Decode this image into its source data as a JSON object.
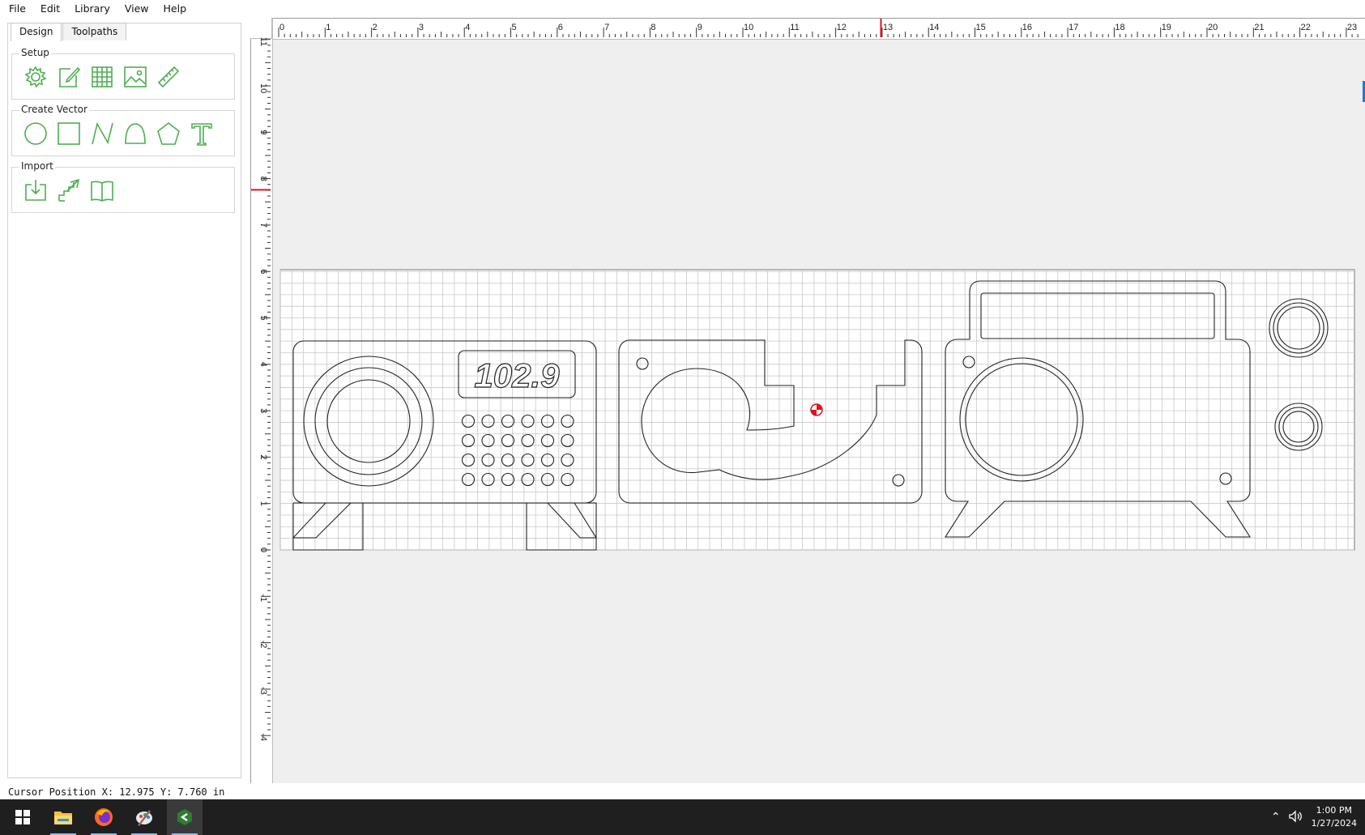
{
  "menu": [
    "File",
    "Edit",
    "Library",
    "View",
    "Help"
  ],
  "tabs": [
    "Design",
    "Toolpaths"
  ],
  "groups": {
    "setup": {
      "label": "Setup",
      "tools": [
        "gear-icon",
        "edit-document-icon",
        "grid-icon",
        "image-icon",
        "ruler-icon"
      ]
    },
    "create_vector": {
      "label": "Create Vector",
      "tools": [
        "circle-icon",
        "rectangle-icon",
        "polyline-icon",
        "curve-icon",
        "polygon-icon",
        "text-icon"
      ]
    },
    "import": {
      "label": "Import",
      "tools": [
        "import-icon",
        "import-steps-icon",
        "library-book-icon"
      ]
    }
  },
  "ruler": {
    "top_labels": [
      "0",
      "1",
      "2",
      "3",
      "4",
      "5",
      "6",
      "7",
      "8",
      "9",
      "10",
      "11",
      "12",
      "13",
      "14",
      "15",
      "16",
      "17",
      "18",
      "19",
      "20",
      "21",
      "22",
      "23"
    ],
    "left_labels": [
      "11",
      "10",
      "9",
      "8",
      "7",
      "6",
      "5",
      "4",
      "3",
      "2",
      "1",
      "0",
      "-1",
      "-2",
      "-3",
      "-4"
    ],
    "cursor_x": 12.975,
    "cursor_y": 7.76
  },
  "design": {
    "display_text": "102.9"
  },
  "status": {
    "cursor_position": "Cursor Position X: 12.975 Y: 7.760 in"
  },
  "taskbar": {
    "apps": [
      "windows-start-icon",
      "file-explorer-icon",
      "firefox-icon",
      "paint-icon",
      "carbide-create-icon"
    ],
    "time": "1:00 PM",
    "date": "1/27/2024"
  },
  "colors": {
    "tool_green": "#4caf50",
    "cursor_red": "#e0141e",
    "accent_blue": "#1e78d7"
  }
}
